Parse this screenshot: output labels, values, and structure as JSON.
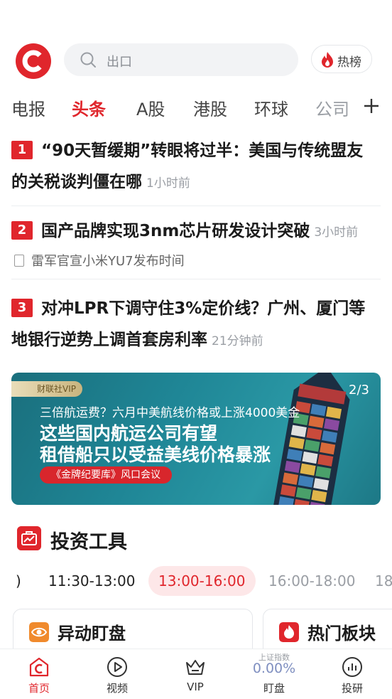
{
  "header": {
    "logo": "cls-logo",
    "search_placeholder": "出口",
    "hot_label": "热榜"
  },
  "tabs": [
    {
      "label": "电报"
    },
    {
      "label": "头条",
      "active": true
    },
    {
      "label": "A股"
    },
    {
      "label": "港股"
    },
    {
      "label": "环球"
    },
    {
      "label": "公司"
    }
  ],
  "news": [
    {
      "rank": "1",
      "title_line1": "“90天暂缓期”转眼将过半：美国与传统盟友",
      "title_line2": "的关税谈判僵在哪",
      "time": "1小时前"
    },
    {
      "rank": "2",
      "title_line1": "国产品牌实现3nm芯片研发设计突破",
      "time": "3小时前",
      "sub": "雷军官宣小米YU7发布时间"
    },
    {
      "rank": "3",
      "title_line1": "对冲LPR下调守住3%定价线？广州、厦门等",
      "title_line2": "地银行逆势上调首套房利率",
      "time": "21分钟前"
    }
  ],
  "banner": {
    "tag": "财联社VIP",
    "pager": "2/3",
    "line1": "三倍航运费？六月中美航线价格或上涨4000美金",
    "line2": "这些国内航运公司有望",
    "line3": "租借船只以受益美线价格暴涨",
    "pill": "《金牌纪要库》风口会议"
  },
  "tools": {
    "title": "投资工具",
    "times": [
      "11:30-13:00",
      "13:00-16:00",
      "16:00-18:00",
      "18"
    ],
    "cards": [
      {
        "label": "异动盯盘",
        "icon": "eye-icon"
      },
      {
        "label": "热门板块",
        "icon": "fire-icon"
      }
    ]
  },
  "bottom_nav": {
    "home": "首页",
    "video": "视频",
    "vip": "VIP",
    "index_label": "上证指数",
    "index_value": "0.00%",
    "watch": "盯盘",
    "research": "投研"
  },
  "colors": {
    "accent": "#e0262c",
    "index_blue": "#7f8fc0"
  }
}
